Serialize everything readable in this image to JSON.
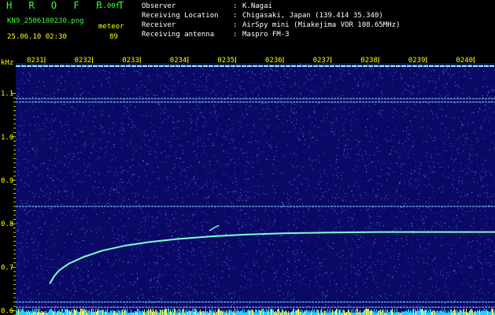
{
  "header": {
    "brand": "H R O F F T",
    "version": "1.00f",
    "filename": "KN9_2506100230.png",
    "detection_type": "meteor",
    "datetime": "25.06.10 02:30",
    "count": "89",
    "info": [
      {
        "label": "Observer",
        "value": "K.Nagai"
      },
      {
        "label": "Receiving Location",
        "value": "Chigasaki, Japan (139.414 35.340)"
      },
      {
        "label": "Receiver",
        "value": "AirSpy mini (Miakejima VOR 108.65MHz)"
      },
      {
        "label": "Receiving antenna",
        "value": "Maspro FM-3"
      }
    ]
  },
  "colors": {
    "background": "#0a0a66",
    "noise": "#3f5fd0",
    "trace": "#7fffd0",
    "text_green": "#3cff3c",
    "text_yellow": "#ffff00",
    "axis_yellow": "#ffff00"
  },
  "chart_data": {
    "type": "heatmap",
    "ylabel": "kHz",
    "ylim": [
      0.59,
      1.17
    ],
    "y_ticks": [
      "1.1",
      "1.0",
      "0.9",
      "0.8",
      "0.7",
      "0.6"
    ],
    "x_ticks": [
      "0231",
      "0232",
      "0233",
      "0234",
      "0235",
      "0236",
      "0237",
      "0238",
      "0239",
      "0240"
    ],
    "horizontal_lines_khz": [
      1.163,
      1.088,
      1.08,
      0.84,
      0.62,
      0.608
    ],
    "meteor_trace": {
      "x_minutes": [
        0.1,
        0.2,
        0.3,
        0.5,
        0.8,
        1.2,
        1.7,
        2.2,
        2.8,
        3.5,
        4.2,
        5.0,
        6.0,
        7.0,
        8.0,
        9.0,
        9.6
      ],
      "y_khz": [
        0.662,
        0.68,
        0.693,
        0.708,
        0.723,
        0.738,
        0.75,
        0.758,
        0.765,
        0.771,
        0.775,
        0.778,
        0.78,
        0.781,
        0.781,
        0.781,
        0.781
      ]
    },
    "short_echo": {
      "x_minutes": [
        3.45,
        3.55,
        3.65
      ],
      "y_khz": [
        0.784,
        0.791,
        0.796
      ]
    }
  }
}
